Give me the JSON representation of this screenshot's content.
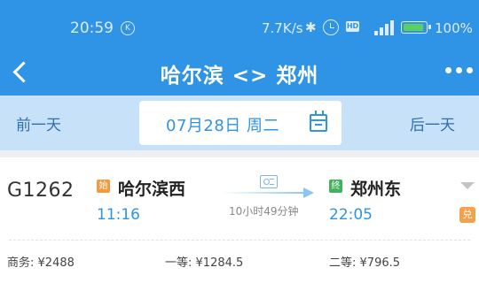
{
  "status_bar": {
    "time": "20:59",
    "notification_badge": "K",
    "network_speed": "7.7K/s",
    "hd_label": "HD",
    "battery_percent": "100%",
    "battery_level": 1.0,
    "colors": {
      "battery_fill": "#58d160"
    }
  },
  "header": {
    "title": "哈尔滨 <> 郑州",
    "back_icon": "back-chevron-icon",
    "more_icon": "more-dots-icon",
    "colors": {
      "background": "#2f93e6"
    }
  },
  "date_bar": {
    "prev_label": "前一天",
    "next_label": "后一天",
    "date_text": "07月28日 周二",
    "calendar_icon": "calendar-icon",
    "colors": {
      "background": "#c7e2f8",
      "accent": "#2f93e6"
    }
  },
  "trains": [
    {
      "train_no": "G1262",
      "from_badge": "始",
      "from_station": "哈尔滨西",
      "departure_time": "11:16",
      "duration": "10小时49分钟",
      "to_badge": "终",
      "to_station": "郑州东",
      "arrival_time": "22:05",
      "ride_tag": "兑",
      "seats": [
        {
          "class_label": "商务:",
          "price": "¥2488"
        },
        {
          "class_label": "一等:",
          "price": "¥1284.5"
        },
        {
          "class_label": "二等:",
          "price": "¥796.5"
        }
      ]
    }
  ]
}
